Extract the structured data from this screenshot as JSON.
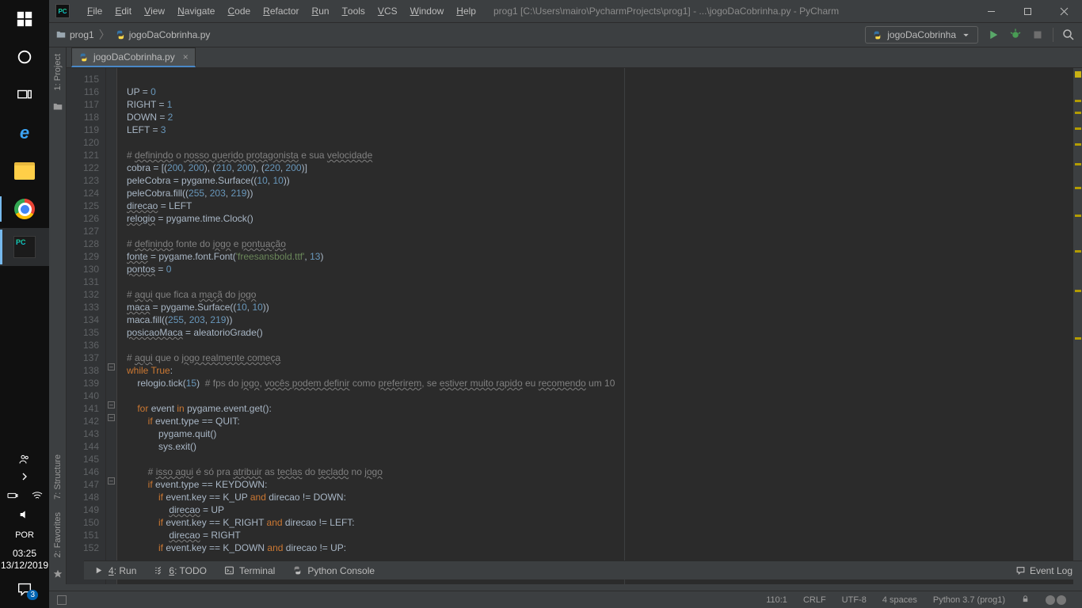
{
  "taskbar": {
    "lang": "POR",
    "time": "03:25",
    "date": "13/12/2019",
    "notif_count": "3"
  },
  "menubar": {
    "items": [
      "File",
      "Edit",
      "View",
      "Navigate",
      "Code",
      "Refactor",
      "Run",
      "Tools",
      "VCS",
      "Window",
      "Help"
    ],
    "title": "prog1 [C:\\Users\\mairo\\PycharmProjects\\prog1] - ...\\jogoDaCobrinha.py - PyCharm"
  },
  "breadcrumbs": {
    "project": "prog1",
    "file": "jogoDaCobrinha.py"
  },
  "run_config": {
    "name": "jogoDaCobrinha"
  },
  "tab": {
    "name": "jogoDaCobrinha.py"
  },
  "left_tools": {
    "project": "1: Project",
    "structure": "7: Structure",
    "favorites": "2: Favorites"
  },
  "bottom_tools": {
    "run": "4: Run",
    "todo": "6: TODO",
    "terminal": "Terminal",
    "python_console": "Python Console",
    "event_log": "Event Log"
  },
  "status": {
    "caret": "110:1",
    "line_sep": "CRLF",
    "encoding": "UTF-8",
    "indent": "4 spaces",
    "interpreter": "Python 3.7 (prog1)"
  },
  "gutter": {
    "start": 115,
    "end": 152
  },
  "code_lines": [
    {
      "n": 115,
      "raw": ""
    },
    {
      "n": 116,
      "html": "UP = <span class='c-num'>0</span>"
    },
    {
      "n": 117,
      "html": "RIGHT = <span class='c-num'>1</span>"
    },
    {
      "n": 118,
      "html": "DOWN = <span class='c-num'>2</span>"
    },
    {
      "n": 119,
      "html": "LEFT = <span class='c-num'>3</span>"
    },
    {
      "n": 120,
      "raw": ""
    },
    {
      "n": 121,
      "html": "<span class='c-cmt'># <span class='c-wavy'>definindo</span> o <span class='c-wavy'>nosso querido protagonista</span> e sua <span class='c-wavy'>velocidade</span></span>"
    },
    {
      "n": 122,
      "html": "cobra = [(<span class='c-num'>200</span>, <span class='c-num'>200</span>), (<span class='c-num'>210</span>, <span class='c-num'>200</span>), (<span class='c-num'>220</span>, <span class='c-num'>200</span>)]"
    },
    {
      "n": 123,
      "html": "peleCobra = pygame.Surface((<span class='c-num'>10</span>, <span class='c-num'>10</span>))"
    },
    {
      "n": 124,
      "html": "peleCobra.fill((<span class='c-num'>255</span>, <span class='c-num'>203</span>, <span class='c-num'>219</span>))"
    },
    {
      "n": 125,
      "html": "<span class='c-wavy'>direcao</span> = LEFT"
    },
    {
      "n": 126,
      "html": "<span class='c-wavy'>relogio</span> = pygame.time.Clock()"
    },
    {
      "n": 127,
      "raw": ""
    },
    {
      "n": 128,
      "html": "<span class='c-cmt'># <span class='c-wavy'>definindo</span> fonte do <span class='c-wavy'>jogo</span> e <span class='c-wavy'>pontuação</span></span>"
    },
    {
      "n": 129,
      "html": "<span class='c-wavy'>fonte</span> = pygame.font.Font(<span class='c-str'>'freesansbold.ttf'</span>, <span class='c-num'>13</span>)"
    },
    {
      "n": 130,
      "html": "<span class='c-wavy'>pontos</span> = <span class='c-num'>0</span>"
    },
    {
      "n": 131,
      "raw": ""
    },
    {
      "n": 132,
      "html": "<span class='c-cmt'># <span class='c-wavy'>aqui</span> que fica a <span class='c-wavy'>maçã</span> do <span class='c-wavy'>jogo</span></span>"
    },
    {
      "n": 133,
      "html": "<span class='c-wavy'>maca</span> = pygame.Surface((<span class='c-num'>10</span>, <span class='c-num'>10</span>))"
    },
    {
      "n": 134,
      "html": "maca.fill((<span class='c-num'>255</span>, <span class='c-num'>203</span>, <span class='c-num'>219</span>))"
    },
    {
      "n": 135,
      "html": "<span class='c-wavy'>posicaoMaca</span> = aleatorioGrade()"
    },
    {
      "n": 136,
      "raw": ""
    },
    {
      "n": 137,
      "html": "<span class='c-cmt'># <span class='c-wavy'>aqui</span> que o <span class='c-wavy'>jogo realmente começa</span></span>"
    },
    {
      "n": 138,
      "html": "<span class='c-kw'>while True</span>:"
    },
    {
      "n": 139,
      "html": "    relogio.tick(<span class='c-num'>15</span>)  <span class='c-cmt'># fps do <span class='c-wavy'>jogo</span>, <span class='c-wavy'>vocês podem definir</span> como <span class='c-wavy'>preferirem</span>, se <span class='c-wavy'>estiver muito rapido</span> eu <span class='c-wavy'>recomendo</span> um 10</span>"
    },
    {
      "n": 140,
      "raw": ""
    },
    {
      "n": 141,
      "html": "    <span class='c-kw'>for</span> event <span class='c-kw'>in</span> pygame.event.get():"
    },
    {
      "n": 142,
      "html": "        <span class='c-kw'>if</span> event.type == QUIT:"
    },
    {
      "n": 143,
      "html": "            pygame.quit()"
    },
    {
      "n": 144,
      "html": "            sys.exit()"
    },
    {
      "n": 145,
      "raw": ""
    },
    {
      "n": 146,
      "html": "        <span class='c-cmt'># <span class='c-wavy'>isso aqui</span> é só pra <span class='c-wavy'>atribuir</span> as <span class='c-wavy'>teclas</span> do <span class='c-wavy'>teclado</span> no <span class='c-wavy'>jogo</span></span>"
    },
    {
      "n": 147,
      "html": "        <span class='c-kw'>if</span> event.type == KEYDOWN:"
    },
    {
      "n": 148,
      "html": "            <span class='c-kw'>if</span> event.key == K_UP <span class='c-kw'>and</span> direcao != DOWN:"
    },
    {
      "n": 149,
      "html": "                <span class='c-wavy'>direcao</span> = UP"
    },
    {
      "n": 150,
      "html": "            <span class='c-kw'>if</span> event.key == K_RIGHT <span class='c-kw'>and</span> direcao != LEFT:"
    },
    {
      "n": 151,
      "html": "                <span class='c-wavy'>direcao</span> = RIGHT"
    },
    {
      "n": 152,
      "html": "            <span class='c-kw'>if</span> event.key == K_DOWN <span class='c-kw'>and</span> direcao != UP:"
    }
  ]
}
